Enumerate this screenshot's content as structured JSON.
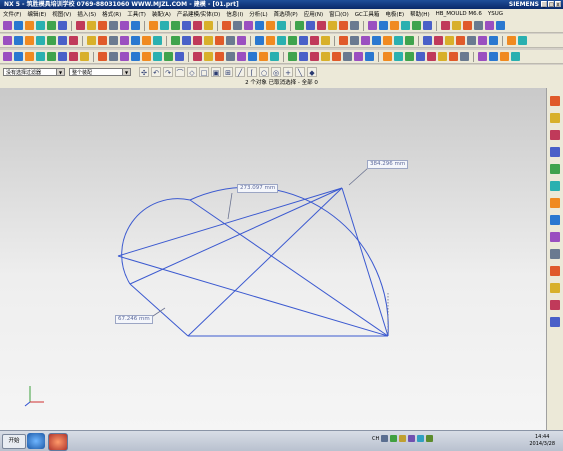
{
  "titlebar": {
    "title": "NX 5 - 筑胜模具培训学校  0769-88031060  WWW.MJZL.COM - 建模 - [01.prt]",
    "brand": "SIEMENS",
    "buttons": [
      "_",
      "□",
      "x"
    ]
  },
  "menu": [
    "文件(F)",
    "编辑(E)",
    "视图(V)",
    "插入(S)",
    "格式(R)",
    "工具(T)",
    "装配(A)",
    "产品建模/实体(D)",
    "信息(I)",
    "分析(L)",
    "首选项(P)",
    "应用(N)",
    "窗口(O)",
    "GC工具箱",
    "电极(E)",
    "帮助(H)",
    "HB_MOULD M6.6",
    "YSUG"
  ],
  "toolbar": {
    "filter_combo": "没有选择过滤器",
    "assembly_combo": "整个装配",
    "status": "2 个对象 已取消选择 - 全部 0"
  },
  "dimensions": [
    "273.097 mm",
    "384.296 mm",
    "67.246 mm"
  ],
  "taskbar": {
    "start_label": "开始",
    "tray_label": "CH",
    "time": "14:44",
    "date": "2014/3/28"
  },
  "colors": {
    "curve": "#3c5ad0",
    "titlebar": "#0a2a6a",
    "background": "#ece9d8"
  }
}
